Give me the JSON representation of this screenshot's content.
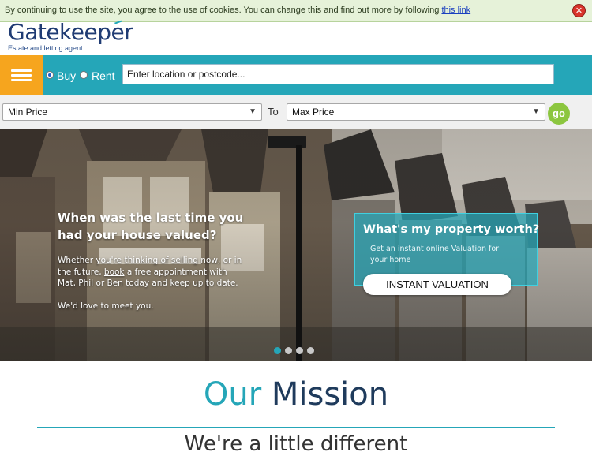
{
  "cookie_bar": {
    "message": "By continuing to use the site, you agree to the use of cookies. You can change this and find out more by following",
    "link_text": "this link",
    "close_symbol": "✕"
  },
  "logo": {
    "name": "Gatekeeper",
    "tagline": "Estate and letting agent"
  },
  "search": {
    "buy_label": "Buy",
    "rent_label": "Rent",
    "selected": "Buy",
    "location_placeholder": "Enter location or postcode...",
    "min_price": "Min Price",
    "to_label": "To",
    "max_price": "Max Price",
    "go_label": "go"
  },
  "hero": {
    "title_line1": "When was the last time you",
    "title_line2": "had your house valued?",
    "body_before_link": "Whether you're thinking of selling now, or in the future,",
    "body_link": "book",
    "body_after_link": "a free appointment with Mat, Phil or Ben today and keep up to date.",
    "meet": "We'd love to meet you.",
    "valuation_title": "What's my property worth?",
    "valuation_sub": "Get an instant online Valuation for your home",
    "valuation_button": "INSTANT VALUATION",
    "slide_count": 4,
    "active_slide": 1
  },
  "mission": {
    "title_part1": "Our",
    "title_part2": "Mission",
    "subtitle": "We're a little different"
  },
  "colors": {
    "teal": "#25a6b8",
    "orange": "#f6a51e",
    "go_green": "#8cc63f",
    "navy": "#1f3b73"
  }
}
